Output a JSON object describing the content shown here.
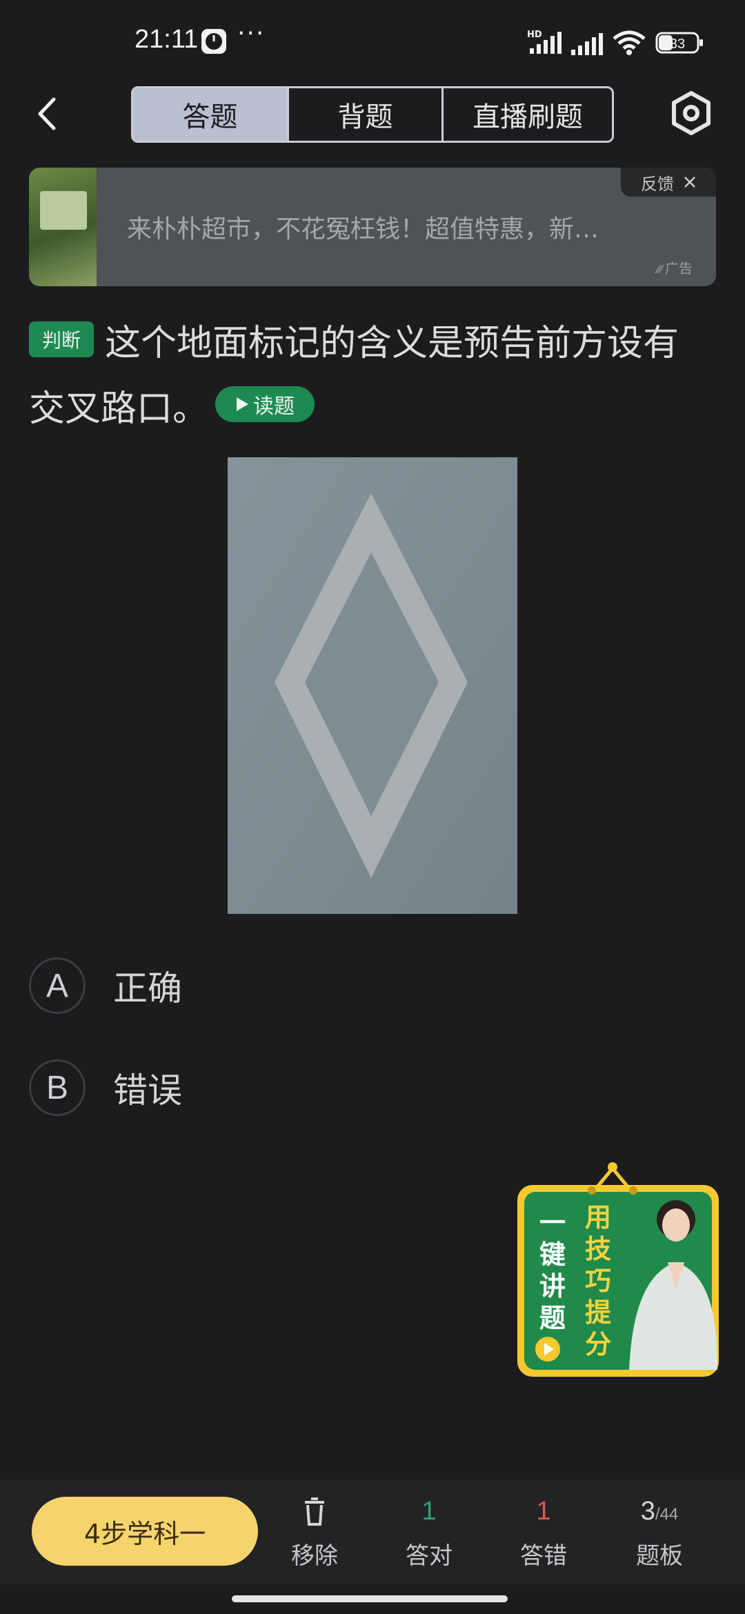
{
  "status_bar": {
    "time": "21:11",
    "more": "···",
    "network_badge": "HD",
    "battery": "33"
  },
  "header": {
    "tabs": [
      {
        "label": "答题",
        "active": true
      },
      {
        "label": "背题",
        "active": false
      },
      {
        "label": "直播刷题",
        "active": false
      }
    ],
    "back_icon": "chevron-left-icon",
    "settings_icon": "gear-icon"
  },
  "ad": {
    "text": "来朴朴超市，不花冤枉钱！超值特惠，新…",
    "feedback": "反馈",
    "tag": "广告"
  },
  "question": {
    "type_badge": "判断",
    "line1": "这个地面标记的含义是预告前方设有",
    "line2": "交叉路口。",
    "read_button": "读题"
  },
  "options": [
    {
      "letter": "A",
      "text": "正确"
    },
    {
      "letter": "B",
      "text": "错误"
    }
  ],
  "promo": {
    "left_text": [
      "一",
      "键",
      "讲",
      "题"
    ],
    "right_text": [
      "用",
      "技",
      "巧",
      "提",
      "分"
    ]
  },
  "bottom_bar": {
    "study_button": "4步学科一",
    "remove_label": "移除",
    "correct_count": "1",
    "correct_label": "答对",
    "wrong_count": "1",
    "wrong_label": "答错",
    "progress_current": "3",
    "progress_total": "/44",
    "board_label": "题板"
  },
  "colors": {
    "accent_green": "#1e8a52",
    "study_yellow": "#f5d46e",
    "correct_green": "#2fa36b",
    "wrong_red": "#e0584a"
  }
}
